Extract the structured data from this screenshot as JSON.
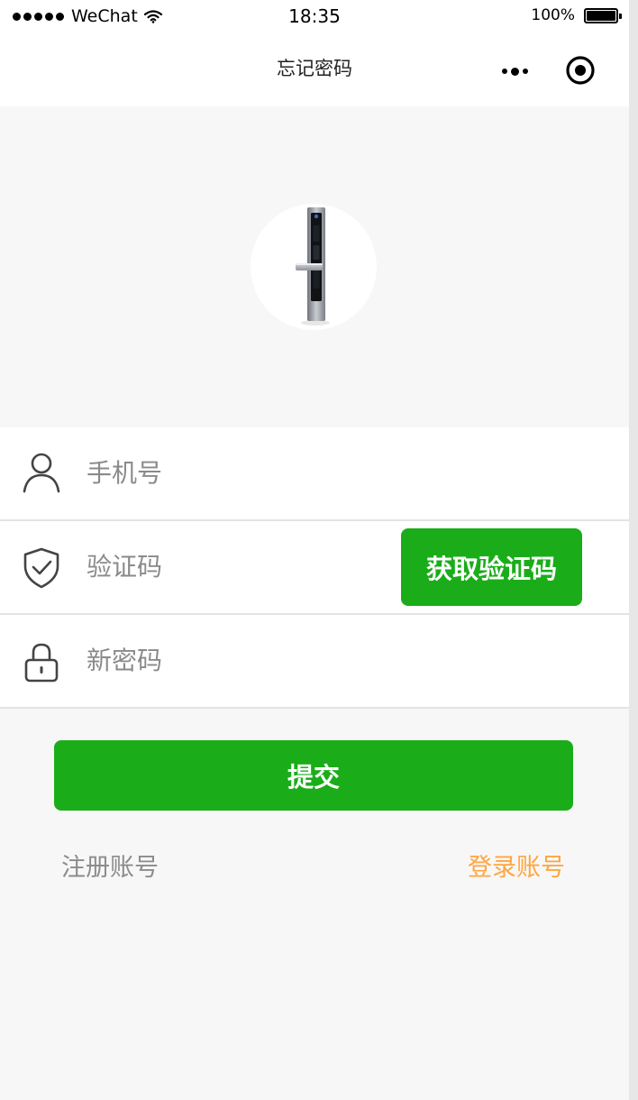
{
  "status_bar": {
    "carrier": "WeChat",
    "time": "18:35",
    "battery": "100%"
  },
  "nav": {
    "title": "忘记密码"
  },
  "form": {
    "phone_placeholder": "手机号",
    "code_placeholder": "验证码",
    "password_placeholder": "新密码",
    "get_code_label": "获取验证码"
  },
  "actions": {
    "submit_label": "提交",
    "register_label": "注册账号",
    "login_label": "登录账号"
  },
  "colors": {
    "primary": "#1aad19",
    "link_accent": "#ffa640",
    "link_muted": "#8c8c8c",
    "background": "#f7f7f7"
  },
  "icons": {
    "phone_row": "user-icon",
    "code_row": "shield-check-icon",
    "password_row": "lock-icon",
    "nav_more": "more-dots-icon",
    "nav_close": "capsule-close-icon"
  }
}
